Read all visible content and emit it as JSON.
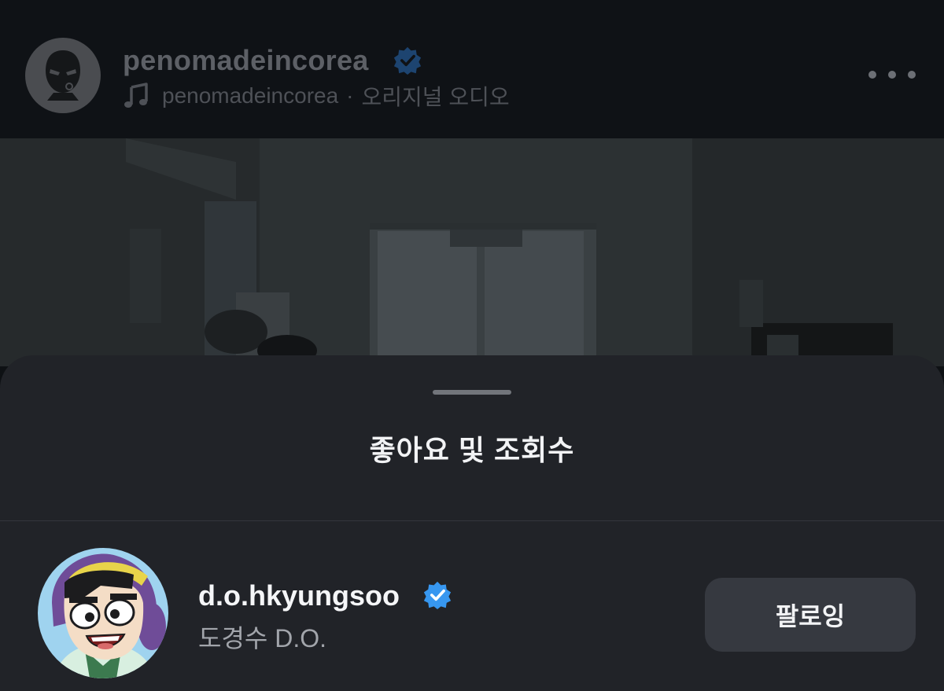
{
  "post": {
    "username": "penomadeincorea",
    "audio_artist": "penomadeincorea",
    "audio_separator": "·",
    "audio_title": "오리지널 오디오",
    "avatar_icon": "masked-face-icon",
    "verified_icon": "verified-badge-icon",
    "more_icon": "more-options-icon"
  },
  "sheet": {
    "title": "좋아요 및 조회수"
  },
  "liker": {
    "username": "d.o.hkyungsoo",
    "full_name": "도경수 D.O.",
    "follow_label": "팔로잉",
    "verified_icon": "verified-badge-icon"
  },
  "colors": {
    "verified": "#3797f0",
    "sheet_bg": "#212328",
    "button_bg": "#363940"
  }
}
